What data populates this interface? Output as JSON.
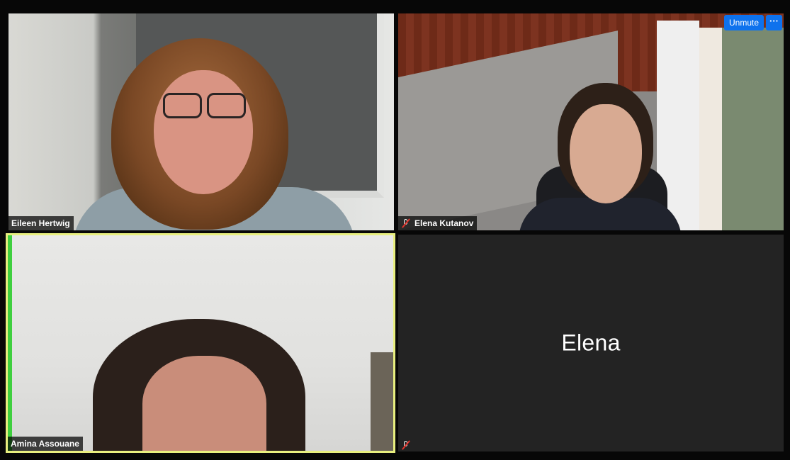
{
  "participants": [
    {
      "name": "Eileen Hertwig",
      "muted": false,
      "video": true
    },
    {
      "name": "Elena Kutanov",
      "muted": true,
      "video": true
    },
    {
      "name": "Amina Assouane",
      "muted": false,
      "video": true,
      "active_speaker": true
    },
    {
      "name": "Elena",
      "muted": true,
      "video": false
    }
  ],
  "controls": {
    "unmute_label": "Unmute",
    "more_label": "···"
  },
  "colors": {
    "accent": "#0e72ed",
    "active_speaker_border": "#e8ef7f",
    "background": "#070707",
    "tile_off": "#232323",
    "mute_red": "#e0332b"
  },
  "icons": {
    "muted": "microphone-muted-icon",
    "more": "ellipsis-icon"
  }
}
